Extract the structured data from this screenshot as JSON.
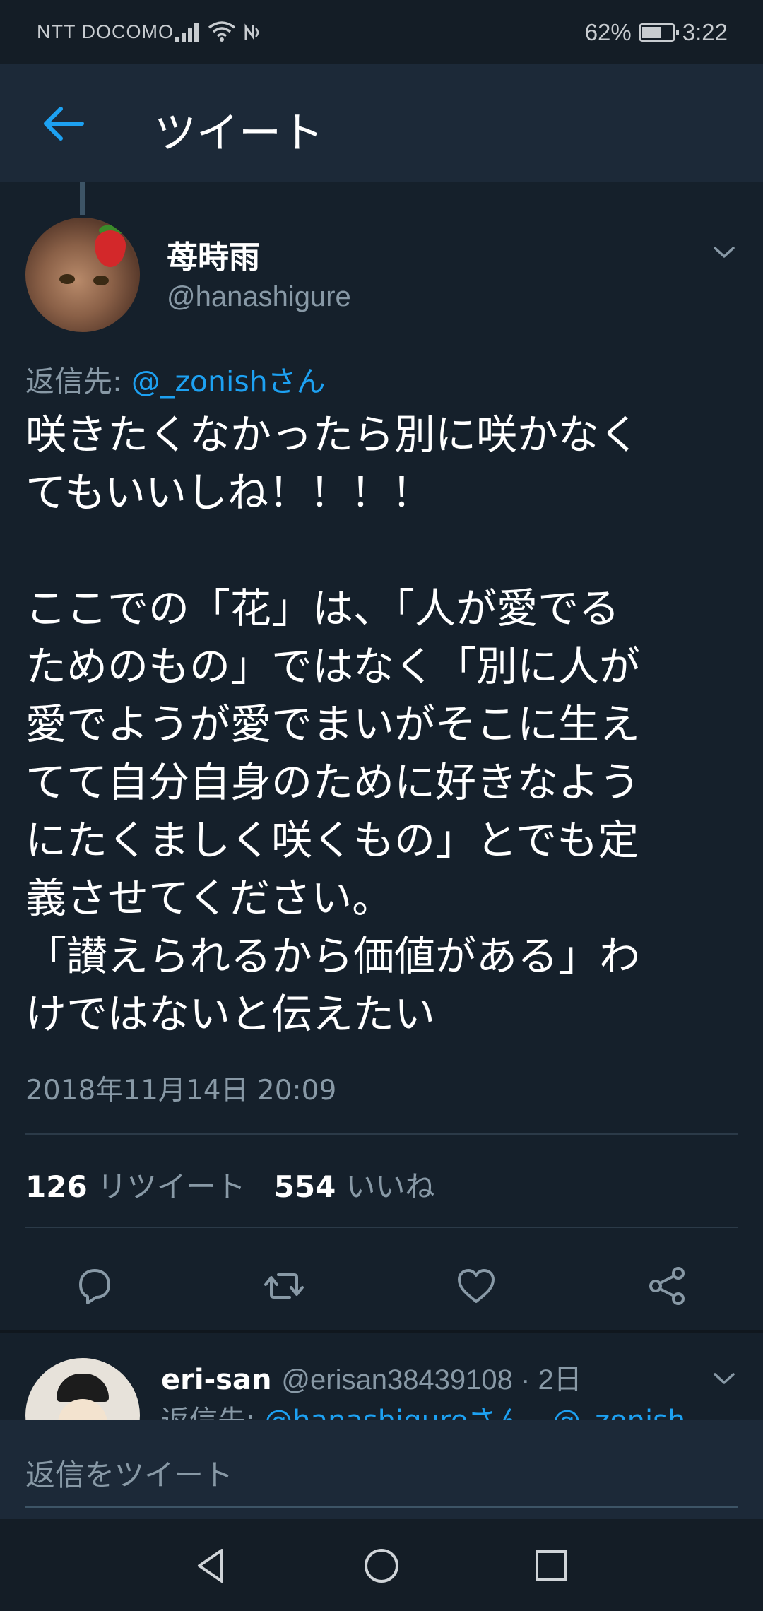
{
  "status_bar": {
    "carrier": "NTT DOCOMO",
    "battery_percent": "62%",
    "battery_level": 0.62,
    "time": "3:22"
  },
  "app_bar": {
    "title": "ツイート",
    "back_icon": "arrow-left-icon"
  },
  "tweet": {
    "author_name": "苺時雨",
    "author_handle": "@hanashigure",
    "reply_to_prefix": "返信先: ",
    "reply_to_mention": "@_zonishさん",
    "text": "咲きたくなかったら別に咲かなく\nてもいいしね！！！！\n\nここでの「花」は、「人が愛でる\nためのもの」ではなく「別に人が\n愛でようが愛でまいがそこに生え\nてて自分自身のために好きなよう\nにたくましく咲くもの」とでも定\n義させてください。\n「讃えられるから価値がある」わ\nけではないと伝えたい",
    "timestamp": "2018年11月14日 20:09",
    "retweet_count": "126",
    "retweet_label": "リツイート",
    "like_count": "554",
    "like_label": "いいね"
  },
  "actions": [
    "reply-icon",
    "retweet-icon",
    "like-icon",
    "share-icon"
  ],
  "reply_preview": {
    "name": "eri-san",
    "handle": "@erisan38439108",
    "time_ago": " · 2日",
    "reply_to_prefix": "返信先: ",
    "reply_to_mentions": "@hanashigureさん、@_zonish"
  },
  "compose": {
    "placeholder": "返信をツイート"
  },
  "colors": {
    "background": "#15202b",
    "header": "#1c2938",
    "accent": "#1da1f2",
    "secondary_text": "#8899a6"
  }
}
